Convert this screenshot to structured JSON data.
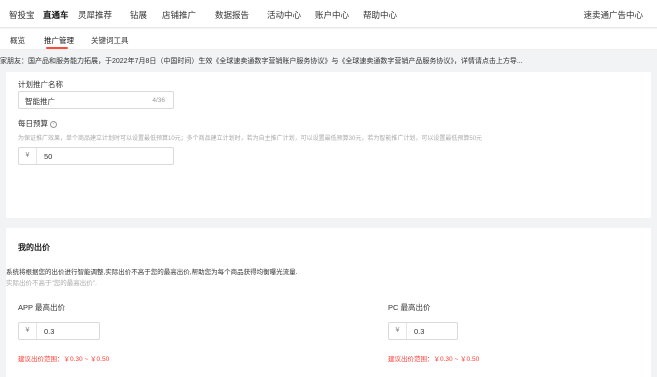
{
  "topnav": {
    "items": [
      "智投宝",
      "直通车",
      "灵犀推荐",
      "钻展",
      "店铺推广",
      "数据报告",
      "活动中心",
      "账户中心",
      "帮助中心"
    ],
    "active_index": 1,
    "right_label": "速卖通广告中心"
  },
  "subnav": {
    "items": [
      "概览",
      "推广管理",
      "关键词工具"
    ],
    "active_index": 1
  },
  "notice": "家朋友：国产品和服务能力拓展，于2022年7月8日（中国时间）生效《全球速卖通数字营销账户服务协议》与《全球速卖通数字营销产品服务协议》，详情请点击上方导...",
  "plan": {
    "name_label": "计划推广名称",
    "name_value": "智能推广",
    "name_count": "4/36",
    "budget_label": "每日预算",
    "help_icon": "question-circle-icon",
    "budget_hint": "为保证推广效果，单个商品建立计划时可以设置最低预算10元；多个商品建立计划时，若为自主推广计划，可以设置最低预算30元，若为智能推广计划，可以设置最低预算50元",
    "currency": "¥",
    "budget_value": "50"
  },
  "bid": {
    "title": "我的出价",
    "desc": "系统将根据您的出价进行智能调整,实际出价不高于您的最高出价,帮助您为每个商品获得均衡曝光流量.",
    "desc_grey": "实际出价不高于\"您的最高出价\".",
    "app_label": "APP 最高出价",
    "app_value": "0.3",
    "app_suggest": "建议出价范围：￥0.30 ~ ￥0.50",
    "pc_label": "PC 最高出价",
    "pc_value": "0.3",
    "pc_suggest": "建议出价范围：￥0.30 ~ ￥0.50"
  },
  "colors": {
    "accent": "#ff4a3a",
    "suggest": "#ff3b30"
  }
}
